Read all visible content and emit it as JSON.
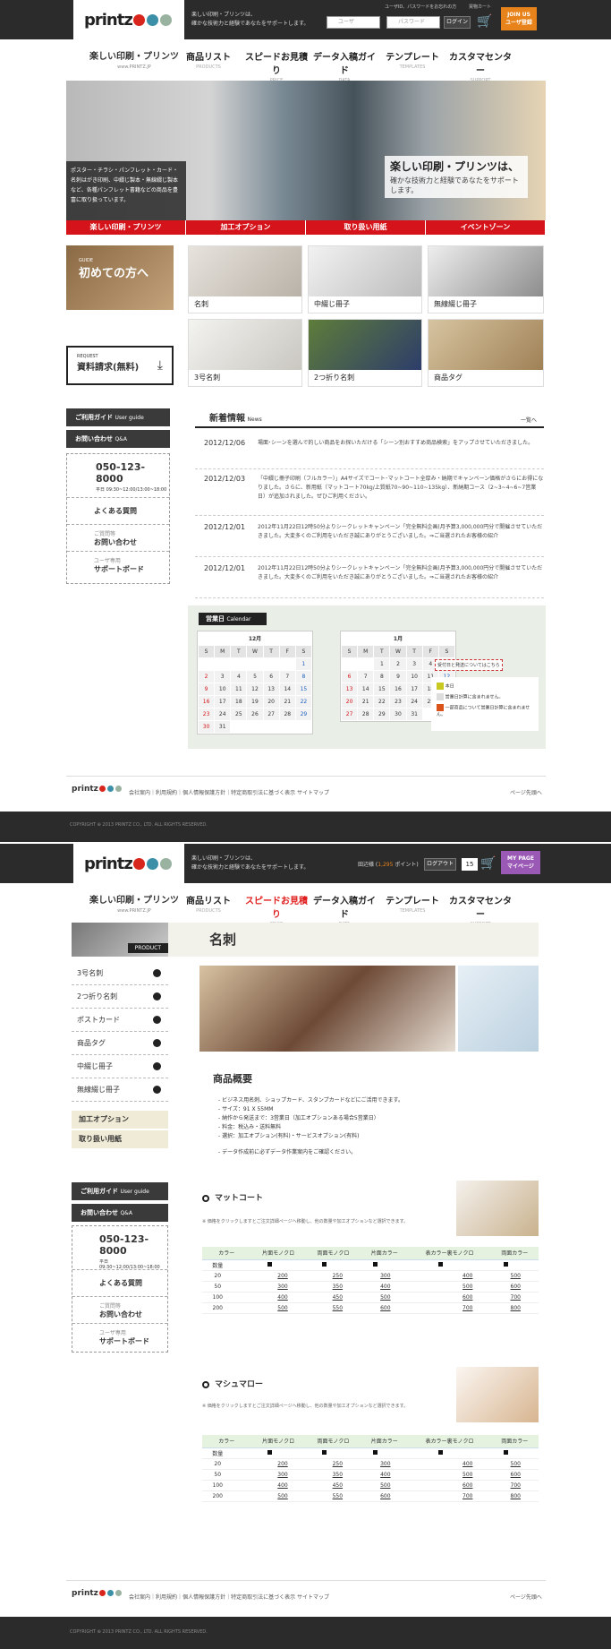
{
  "header": {
    "tagline1": "楽しい印刷・プリンツは、",
    "tagline2": "確かな技術力と経験であなたをサポートします。",
    "login_hint": "ユーザID、パスワードをお忘れの方",
    "user_placeholder": "ユーザ",
    "pass_placeholder": "パスワード",
    "login_label": "ログイン",
    "cart_label": "買物カート",
    "join_label1": "JOIN US",
    "join_label2": "ユーザ登録",
    "logo": "printz"
  },
  "nav": {
    "brand": "楽しい印刷・プリンツ",
    "brand_url": "www.PRINTZ.JP",
    "items": [
      {
        "jp": "商品リスト",
        "en": "PRODUCTS"
      },
      {
        "jp": "スピードお見積り",
        "en": "PRICE"
      },
      {
        "jp": "データ入稿ガイド",
        "en": "DATA"
      },
      {
        "jp": "テンプレート",
        "en": "TEMPLATES"
      },
      {
        "jp": "カスタマセンター",
        "en": "SUPPORT"
      }
    ]
  },
  "hero": {
    "headline": "楽しい印刷・プリンツは、",
    "sub": "確かな技術力と経験であなたをサポートします。",
    "panel": "ポスター・チラシ・パンフレット・カード・名刺はがき印刷、中綴じ製本・無線綴じ製本など、各種パンフレット書籍などの商品を豊富に取り扱っています。",
    "tabs": [
      "楽しい印刷・プリンツ",
      "加工オプション",
      "取り扱い用紙",
      "イベントゾーン"
    ]
  },
  "guide": {
    "label": "GUIDE",
    "title": "初めての方へ"
  },
  "request": {
    "label": "REQUEST",
    "title": "資料請求(無料)"
  },
  "products": [
    "名刺",
    "中綴じ冊子",
    "無線綴じ冊子",
    "3号名刺",
    "2つ折り名刺",
    "商品タグ"
  ],
  "side": {
    "guide": "ご利用ガイド",
    "guide_en": "User guide",
    "contact": "お問い合わせ",
    "contact_en": "Q&A",
    "tel": "050-123-8000",
    "hours": "平日 09:30~12:00/13:00~18:00",
    "faq": "よくある質問",
    "inq_small": "ご質問等",
    "inq": "お問い合わせ",
    "support_small": "ユーザ専用",
    "support": "サポートボード"
  },
  "news": {
    "title": "新着情報",
    "title_en": "News",
    "more": "一覧へ",
    "items": [
      {
        "date": "2012/12/06",
        "text": "場面･シーンを選んで的しい商品をお探いただける「シーン別おすすめ商品検索」をアップさせていただきました。"
      },
      {
        "date": "2012/12/03",
        "text": "「中綴じ冊子印刷（フルカラー）」A4サイズでコート･マットコート全厚み・納期でキャンペーン価格がさらにお得になりました。さらに、新用紙（マットコート70kg/上質紙70~90~110~135kg）、新納期コース（2~3~4~6~7営業日）が追加されました。ぜひご利用ください。"
      },
      {
        "date": "2012/12/01",
        "text": "2012年11月22日12時50分よりシークレットキャンペーン「完全無料企画(月予算3,000,000円分で開催させていただきました。大変多くのご利用をいただき誠にありがとうございました。⇒ご当選されたお客様の紹介"
      },
      {
        "date": "2012/12/01",
        "text": "2012年11月22日12時50分よりシークレットキャンペーン「完全無料企画(月予算3,000,000円分で開催させていただきました。大変多くのご利用をいただき誠にありがとうございました。⇒ご当選されたお客様の紹介"
      }
    ]
  },
  "calendar": {
    "title": "営業日",
    "title_en": "Calendar",
    "m1": "12月",
    "m2": "1月",
    "dow": [
      "S",
      "M",
      "T",
      "W",
      "T",
      "F",
      "S"
    ],
    "dec": [
      [
        "",
        "",
        "",
        "",
        "",
        "",
        "1"
      ],
      [
        "2",
        "3",
        "4",
        "5",
        "6",
        "7",
        "8"
      ],
      [
        "9",
        "10",
        "11",
        "12",
        "13",
        "14",
        "15"
      ],
      [
        "16",
        "17",
        "18",
        "19",
        "20",
        "21",
        "22"
      ],
      [
        "23",
        "24",
        "25",
        "26",
        "27",
        "28",
        "29"
      ],
      [
        "30",
        "31",
        "",
        "",
        "",
        "",
        ""
      ]
    ],
    "jan": [
      [
        "",
        "",
        "1",
        "2",
        "3",
        "4",
        "5"
      ],
      [
        "6",
        "7",
        "8",
        "9",
        "10",
        "11",
        "12"
      ],
      [
        "13",
        "14",
        "15",
        "16",
        "17",
        "18",
        "19"
      ],
      [
        "20",
        "21",
        "22",
        "23",
        "24",
        "25",
        "26"
      ],
      [
        "27",
        "28",
        "29",
        "30",
        "31",
        "",
        ""
      ]
    ],
    "note": "受付日と発送についてはこちら",
    "legend": [
      "本日",
      "営業日計算に含まれません。",
      "一部商品について営業日計算に含まれません。"
    ]
  },
  "footer": {
    "links": [
      "会社案内",
      "利用規約",
      "個人情報保護方針",
      "特定商取引法に基づく表示",
      "サイトマップ"
    ],
    "top": "ページ先頭へ",
    "copy": "COPYRIGHT ⊕ 2013 PRINTZ CO., LTD. ALL RIGHTS RESERVED."
  },
  "header2": {
    "user": "田辺様",
    "points": "1,295",
    "points_label": "ポイント",
    "logout": "ログアウト",
    "cart_count": "15",
    "mypage1": "MY PAGE",
    "mypage2": "マイページ"
  },
  "product_page": {
    "label": "PRODUCT",
    "title": "名刺",
    "cats": [
      "3号名刺",
      "2つ折り名刺",
      "ポストカード",
      "商品タグ",
      "中綴じ冊子",
      "無線綴じ冊子"
    ],
    "subs": [
      "加工オプション",
      "取り扱い用紙"
    ],
    "overview_title": "商品概要",
    "overview": [
      "ビジネス用名刺、ショップカード、スタンプカードなどにご活用できます。",
      "サイズ：91 X 55MM",
      "納作から発送まで：3営業日（加工オプションある場合5営業日）",
      "料金：税込み・送料無料",
      "選択：加工オプション(有料)・サービスオプション(有料)"
    ],
    "overview_note": "データ作成前に必ずデータ作業案内をご確認ください。",
    "sec1": "マットコート",
    "sec2": "マシュマロー",
    "note": "※ 価格をクリックしますとご注文詳細ページへ移動し、他の数量や加工オプションなど選択できます。",
    "cols": [
      "カラー",
      "片面モノクロ",
      "両面モノクロ",
      "片面カラー",
      "表カラー裏モノクロ",
      "両面カラー"
    ],
    "qty": "数量",
    "rows": [
      [
        "20",
        "200",
        "250",
        "300",
        "400",
        "500"
      ],
      [
        "50",
        "300",
        "350",
        "400",
        "500",
        "600"
      ],
      [
        "100",
        "400",
        "450",
        "500",
        "600",
        "700"
      ],
      [
        "200",
        "500",
        "550",
        "600",
        "700",
        "800"
      ]
    ]
  }
}
